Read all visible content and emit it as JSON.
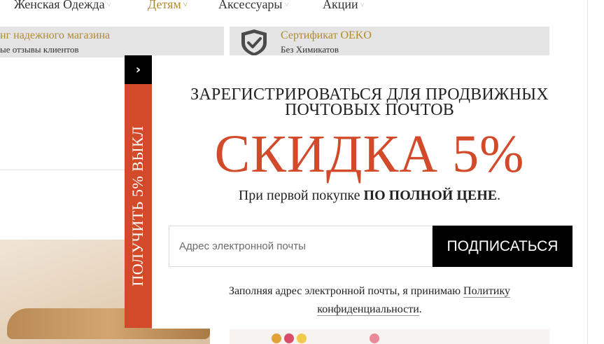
{
  "nav": {
    "items": [
      {
        "label": "Женская Одежда",
        "chevron": "˅"
      },
      {
        "label": "Детям",
        "chevron": "˅"
      },
      {
        "label": "Аксессуары",
        "chevron": "˅"
      },
      {
        "label": "Акции",
        "chevron": "˅"
      }
    ]
  },
  "info": {
    "left_title": "нг надежного магазина",
    "left_sub": "ые отзывы клиентов",
    "right_title": "Сертификат OEKO",
    "right_sub": "Без Химикатов",
    "right_icon": "shield-check-icon"
  },
  "popup": {
    "toggle_icon": "›",
    "tab_label": "ПОЛУЧИТЬ 5% ВЫКЛ",
    "heading_line1": "ЗАРЕГИСТРИРОВАТЬСЯ ДЛЯ ПРОДВИЖНЫХ",
    "heading_line2": "ПОЧТОВЫХ ПОЧТОВ",
    "discount": "СКИДКА 5%",
    "sub_prefix": "При первой покупке ",
    "sub_bold": "ПО ПОЛНОЙ ЦЕНЕ",
    "sub_suffix": ".",
    "email_placeholder": "Адрес электронной почты",
    "email_value": "",
    "subscribe_label": "ПОДПИСАТЬСЯ",
    "legal_prefix": "Заполняя адрес электронной почты, я принимаю ",
    "legal_link": "Политику конфиденциальности",
    "legal_suffix": ".",
    "accent_color": "#d24a2a"
  }
}
